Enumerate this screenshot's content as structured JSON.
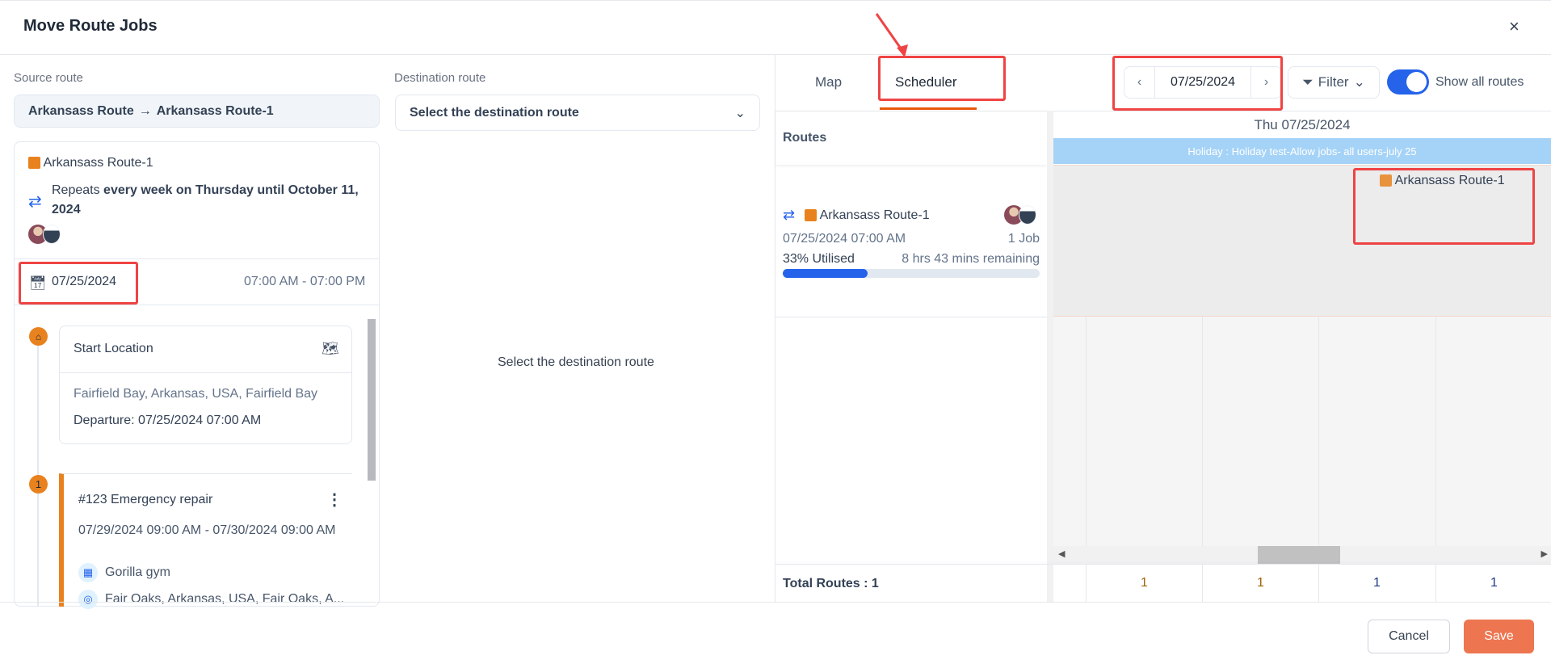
{
  "dialog": {
    "title": "Move Route Jobs",
    "close_icon": "×"
  },
  "source": {
    "label": "Source route",
    "from": "Arkansass Route",
    "arrow": "→",
    "to": "Arkansass Route-1",
    "route_name": "Arkansass Route-1",
    "repeats_prefix": "Repeats",
    "repeats_text": "every week on Thursday until October 11, 2024",
    "date": "07/25/2024",
    "time_range": "07:00 AM - 07:00 PM",
    "start": {
      "title": "Start Location",
      "address": "Fairfield Bay, Arkansas, USA, Fairfield Bay",
      "departure": "Departure: 07/25/2024 07:00 AM"
    },
    "job": {
      "number": "1",
      "title": "#123 Emergency repair",
      "time": "07/29/2024 09:00 AM - 07/30/2024 09:00 AM",
      "customer": "Gorilla gym",
      "address": "Fair Oaks, Arkansas, USA, Fair Oaks, A..."
    }
  },
  "destination": {
    "label": "Destination route",
    "placeholder": "Select the destination route",
    "empty": "Select the destination route"
  },
  "scheduler": {
    "tabs": [
      "Map",
      "Scheduler"
    ],
    "active_tab": "Scheduler",
    "date": "07/25/2024",
    "filter": "Filter",
    "toggle_label": "Show all routes",
    "toggle_on": true,
    "routes_header": "Routes",
    "day_header": "Thu 07/25/2024",
    "holiday": "Holiday : Holiday test-Allow jobs- all users-july 25",
    "route": {
      "name": "Arkansass Route-1",
      "datetime": "07/25/2024 07:00 AM",
      "jobs": "1 Job",
      "utilised": "33% Utilised",
      "remaining": "8 hrs 43 mins remaining",
      "utilisation_percent": 33
    },
    "event": "Arkansass Route-1",
    "total_label": "Total Routes : 1",
    "totals": [
      "1",
      "1",
      "1",
      "1"
    ]
  },
  "colors": {
    "accent": "#e8821f",
    "primary": "#2563eb",
    "save": "#ed7650",
    "holiday": "#a5d3f7",
    "highlight": "#ef4444"
  },
  "footer": {
    "cancel": "Cancel",
    "save": "Save"
  }
}
